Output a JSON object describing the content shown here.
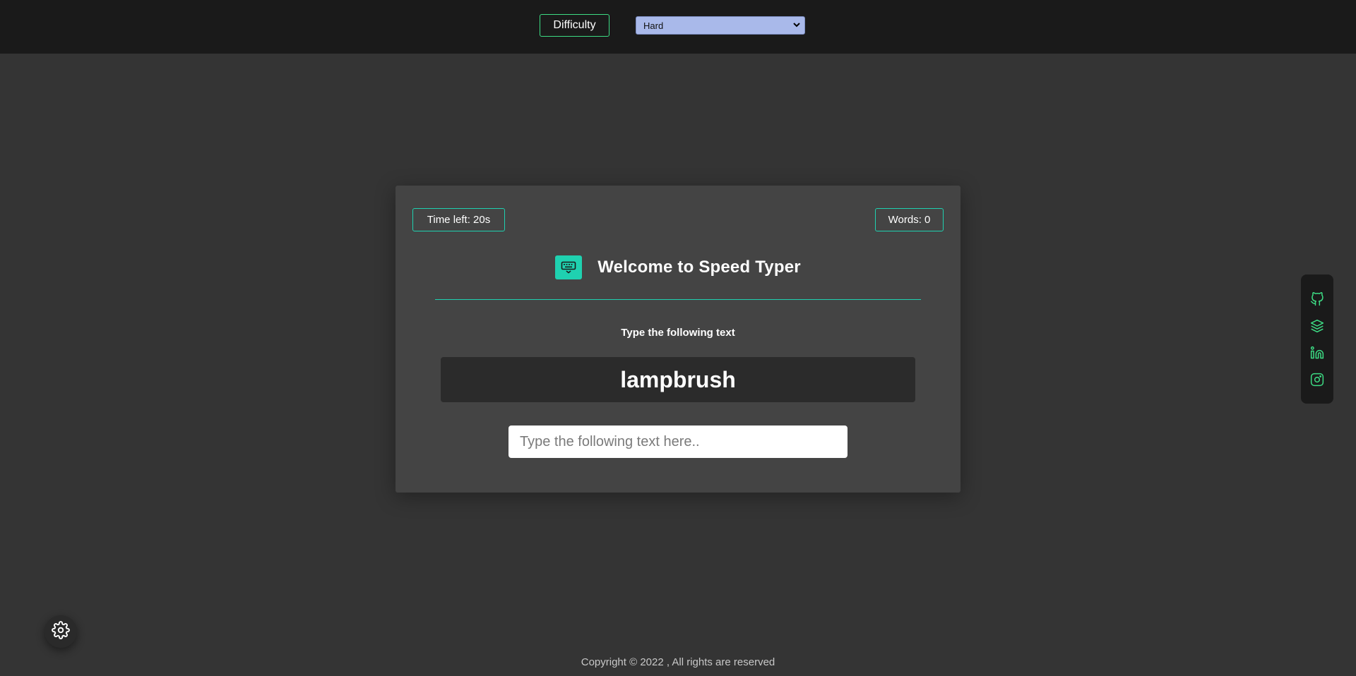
{
  "header": {
    "difficulty_label": "Difficulty",
    "difficulty_selected": "Hard"
  },
  "game": {
    "time_left": "Time left: 20s",
    "words": "Words: 0",
    "title": "Welcome to Speed Typer",
    "instruction": "Type the following text",
    "current_word": "lampbrush",
    "input_placeholder": "Type the following text here..",
    "input_value": ""
  },
  "social_links": [
    {
      "name": "github-icon"
    },
    {
      "name": "layers-icon"
    },
    {
      "name": "linkedin-icon"
    },
    {
      "name": "instagram-icon"
    }
  ],
  "footer": {
    "copyright": "Copyright © 2022 , All rights are reserved"
  },
  "colors": {
    "accent_teal": "#1fd1b0",
    "accent_green": "#3ddc84",
    "page_bg": "#343434",
    "card_bg": "#444444",
    "topbar_bg": "#1a1a1a",
    "select_bg": "#a9b9ea"
  }
}
